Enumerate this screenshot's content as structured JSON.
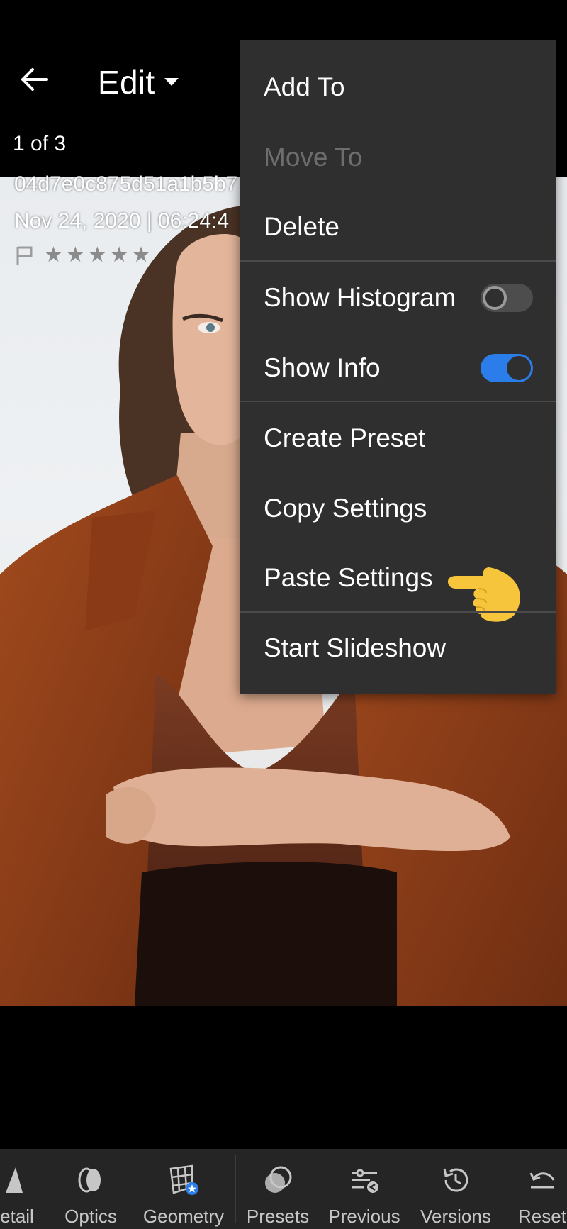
{
  "header": {
    "mode_label": "Edit",
    "counter": "1 of 3"
  },
  "photo_info": {
    "filename": "04d7e0c875d51a1b5b7",
    "datetime": "Nov 24, 2020 | 06:24:4",
    "stars": [
      "★",
      "★",
      "★",
      "★",
      "★"
    ]
  },
  "menu": {
    "add_to": "Add To",
    "move_to": "Move To",
    "delete": "Delete",
    "show_histogram": "Show Histogram",
    "show_histogram_on": false,
    "show_info": "Show Info",
    "show_info_on": true,
    "create_preset": "Create Preset",
    "copy_settings": "Copy Settings",
    "paste_settings": "Paste Settings",
    "start_slideshow": "Start Slideshow"
  },
  "toolbar": {
    "detail": "etail",
    "optics": "Optics",
    "geometry": "Geometry",
    "presets": "Presets",
    "previous": "Previous",
    "versions": "Versions",
    "reset": "Reset"
  },
  "colors": {
    "accent_blue": "#2b7de9",
    "menu_bg": "#2f2f2f",
    "pointer_yellow": "#f7c53b"
  },
  "icons": [
    "back-arrow-icon",
    "dropdown-caret-icon",
    "flag-icon",
    "star-icon",
    "pointing-hand-icon",
    "detail-icon",
    "optics-icon",
    "geometry-icon",
    "presets-icon",
    "previous-icon",
    "versions-icon",
    "reset-icon"
  ]
}
